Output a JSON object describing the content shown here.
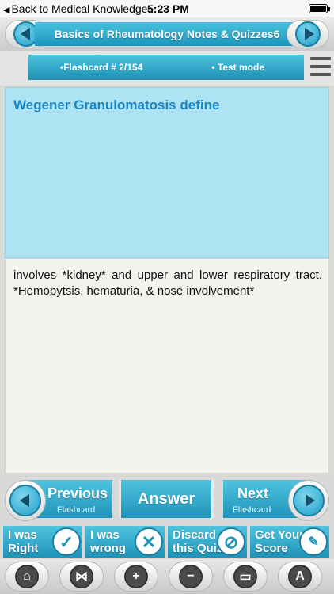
{
  "status_bar": {
    "back_label": "Back to Medical Knowledge...",
    "time": "5:23 PM"
  },
  "header": {
    "title": "Basics of Rheumatology Notes & Quizzes6"
  },
  "info_bar": {
    "flashcard_label": "•Flashcard #  2/154",
    "mode_label": "• Test mode"
  },
  "card": {
    "question": "Wegener Granulomatosis define",
    "answer": "involves *kidney* and upper and lower respiratory tract. *Hemopytsis, hematuria, & nose involvement*"
  },
  "nav": {
    "previous_label": "Previous",
    "previous_sub": "Flashcard",
    "answer_label": "Answer",
    "next_label": "Next",
    "next_sub": "Flashcard"
  },
  "actions": [
    {
      "label": "I was Right",
      "icon": "check-icon"
    },
    {
      "label": "I was wrong",
      "icon": "x-icon"
    },
    {
      "label": "Discard this Quiz",
      "icon": "no-icon"
    },
    {
      "label": "Get Your Score",
      "icon": "score-icon"
    }
  ],
  "toolbar_icons": [
    "home-icon",
    "share-icon",
    "zoom-in-icon",
    "zoom-out-icon",
    "whiteboard-icon",
    "font-icon"
  ],
  "colors": {
    "accent": "#2fa9cf",
    "question_bg": "#aee3f3",
    "question_text": "#1b86c6"
  }
}
